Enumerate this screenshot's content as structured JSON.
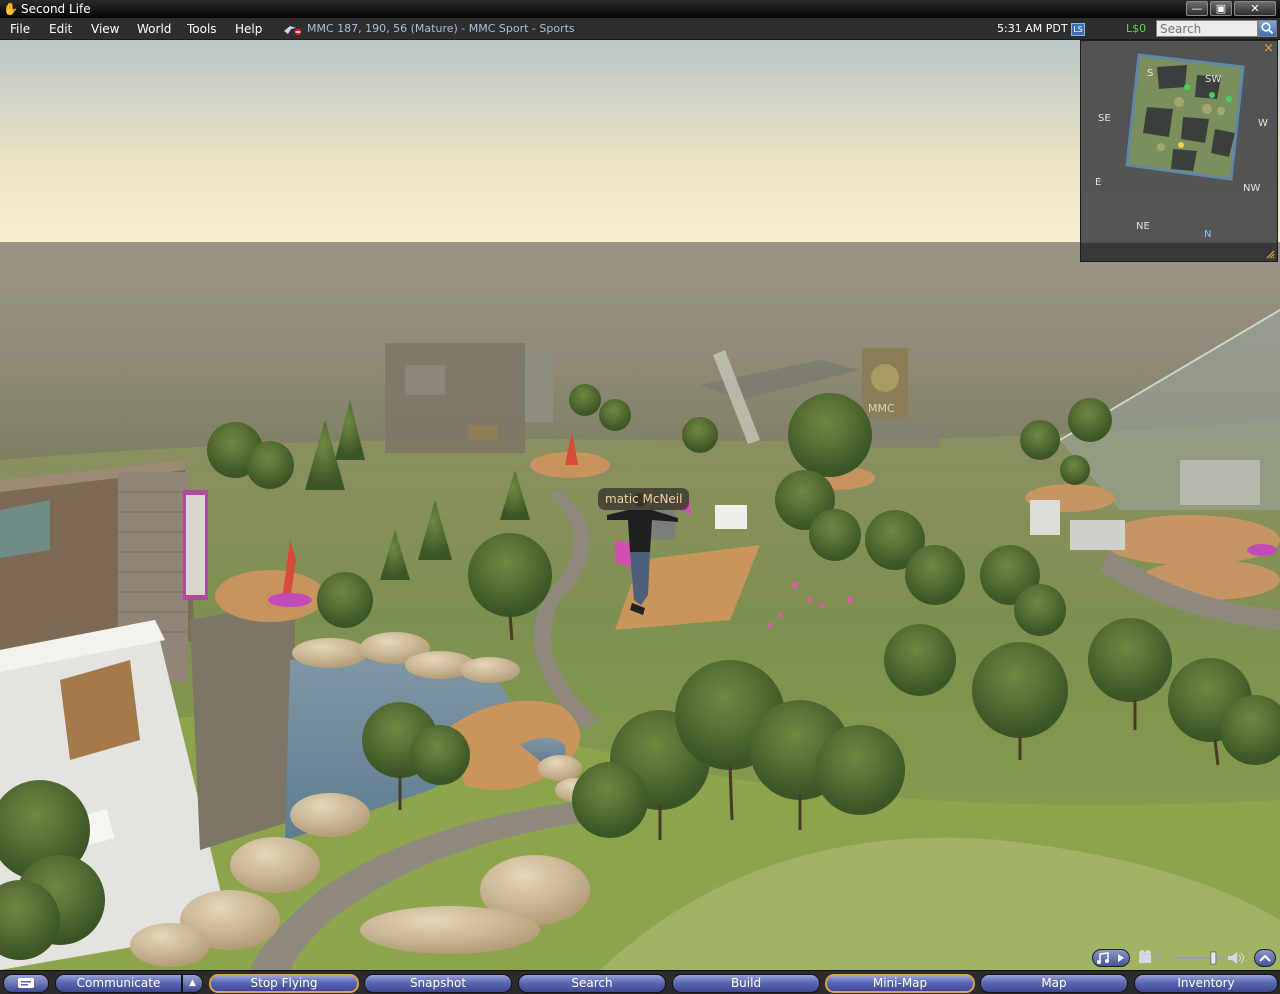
{
  "window": {
    "title": "Second Life",
    "minimize": "—",
    "maximize": "▣",
    "close": "✕"
  },
  "menu": {
    "items": [
      "File",
      "Edit",
      "View",
      "World",
      "Tools",
      "Help"
    ]
  },
  "status": {
    "location": "MMC 187, 190, 56 (Mature) - MMC Sport - Sports",
    "time": "5:31 AM PDT",
    "ls_badge": "LS",
    "balance": "L$0",
    "search_placeholder": "Search"
  },
  "scene": {
    "avatar_name": "matic McNeil",
    "building_sign": "MMC"
  },
  "minimap": {
    "compass": {
      "s": "S",
      "sw": "SW",
      "se": "SE",
      "w": "W",
      "e": "E",
      "nw": "NW",
      "ne": "NE",
      "n": "N"
    },
    "close": "×"
  },
  "toolbar": {
    "communicate": "Communicate",
    "stop_flying": "Stop Flying",
    "snapshot": "Snapshot",
    "search": "Search",
    "build": "Build",
    "mini_map": "Mini-Map",
    "map": "Map",
    "inventory": "Inventory"
  },
  "media": {
    "volume_level": 0.85
  },
  "colors": {
    "accent_green": "#4fdc4f",
    "name_tag": "#f5d3a0",
    "button_active_border": "#d7a04a",
    "location_text": "#a9bdd8"
  }
}
